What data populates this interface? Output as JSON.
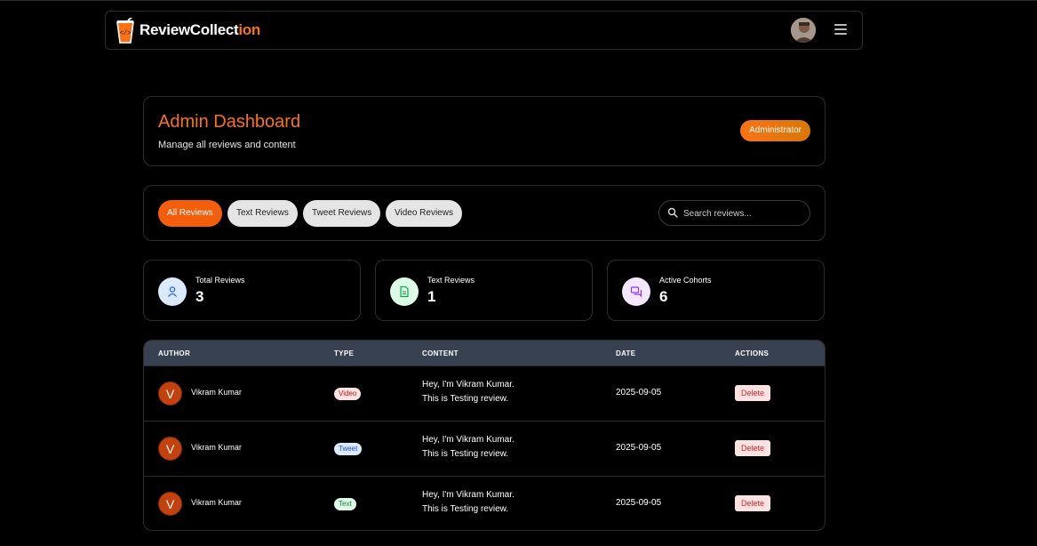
{
  "app": {
    "brand_main": "ReviewCollect",
    "brand_accent": "ion",
    "accent_color": "#f97316"
  },
  "header": {
    "title": "Admin Dashboard",
    "subtitle": "Manage all reviews and content",
    "role_badge": "Administrator"
  },
  "filters": {
    "tabs": [
      {
        "label": "All Reviews",
        "active": true
      },
      {
        "label": "Text Reviews",
        "active": false
      },
      {
        "label": "Tweet Reviews",
        "active": false
      },
      {
        "label": "Video Reviews",
        "active": false
      }
    ],
    "search_placeholder": "Search reviews..."
  },
  "stats": [
    {
      "label": "Total Reviews",
      "value": "3",
      "icon": "user-icon"
    },
    {
      "label": "Text Reviews",
      "value": "1",
      "icon": "document-icon"
    },
    {
      "label": "Active Cohorts",
      "value": "6",
      "icon": "chat-icon"
    }
  ],
  "table": {
    "columns": [
      "AUTHOR",
      "TYPE",
      "CONTENT",
      "DATE",
      "ACTIONS"
    ],
    "rows": [
      {
        "initial": "V",
        "author": "Vikram Kumar",
        "type": "Video",
        "content_line1": "Hey, I'm Vikram Kumar.",
        "content_line2": "This is Testing review.",
        "date": "2025-09-05",
        "action": "Delete"
      },
      {
        "initial": "V",
        "author": "Vikram Kumar",
        "type": "Tweet",
        "content_line1": "Hey, I'm Vikram Kumar.",
        "content_line2": "This is Testing review.",
        "date": "2025-09-05",
        "action": "Delete"
      },
      {
        "initial": "V",
        "author": "Vikram Kumar",
        "type": "Text",
        "content_line1": "Hey, I'm Vikram Kumar.",
        "content_line2": "This is Testing review.",
        "date": "2025-09-05",
        "action": "Delete"
      }
    ]
  }
}
